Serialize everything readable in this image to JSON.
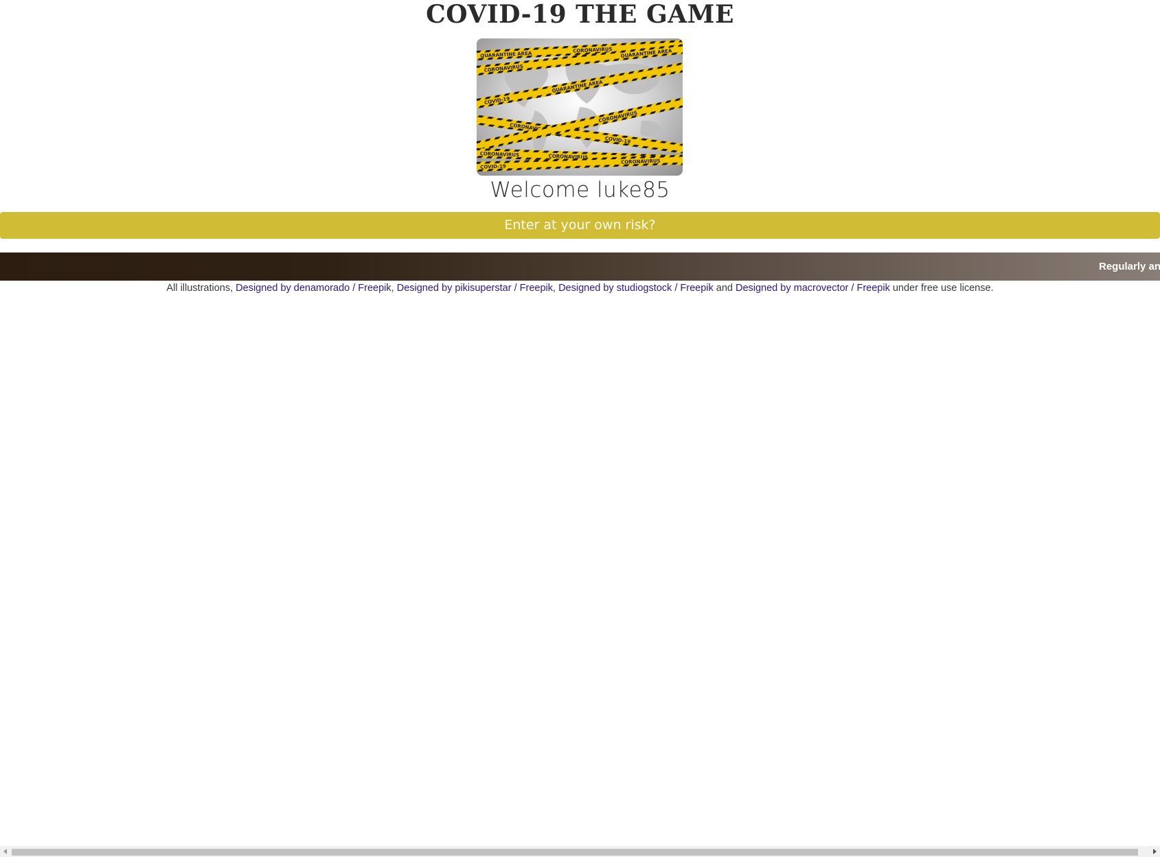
{
  "game": {
    "title": "COVID-19 THE GAME",
    "welcome": "Welcome luke85",
    "enter_button_label": "Enter at your own risk?",
    "hero_image": {
      "tape_labels": [
        "QUARANTINE AREA",
        "CORONAVIRUS",
        "COVID-19",
        "QUARANTINE AREA",
        "CORONAVIRUS",
        "COVID-19"
      ]
    }
  },
  "ticker": {
    "text": "Regularly and t"
  },
  "credits": {
    "prefix": "All illustrations, ",
    "links": [
      "Designed by denamorado / Freepik",
      "Designed by pikisuperstar / Freepik",
      "Designed by studiogstock / Freepik",
      "Designed by macrovector / Freepik"
    ],
    "separator": ", ",
    "and_word": " and ",
    "suffix": " under free use license."
  },
  "colors": {
    "enter_button": "#d1bc36",
    "link": "#2a1a8c",
    "tape_yellow": "#f2c500",
    "tape_black": "#1a1a1a"
  },
  "icons": {
    "scroll_left": "triangle-left-icon",
    "scroll_right": "triangle-right-icon"
  }
}
